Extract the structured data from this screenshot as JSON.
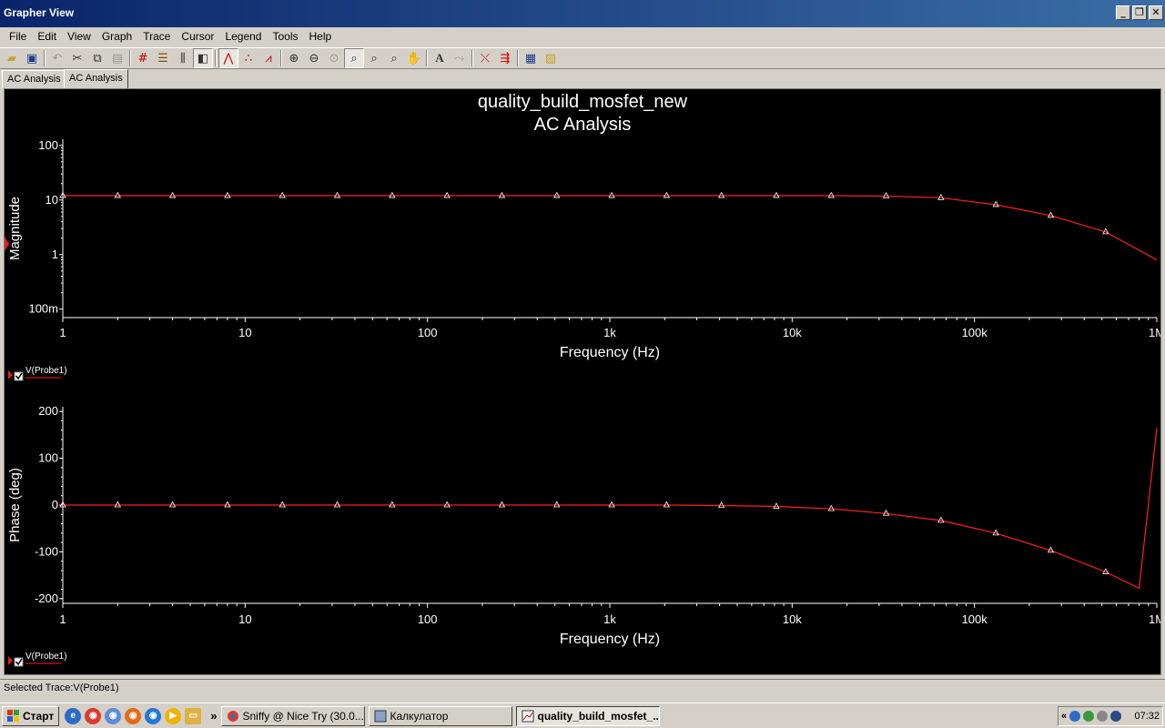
{
  "window": {
    "title": "Grapher View",
    "controls": [
      "_",
      "❐",
      "✕"
    ]
  },
  "menu": [
    "File",
    "Edit",
    "View",
    "Graph",
    "Trace",
    "Cursor",
    "Legend",
    "Tools",
    "Help"
  ],
  "tabs": [
    {
      "label": "AC Analysis",
      "active": false
    },
    {
      "label": "AC Analysis",
      "active": true
    }
  ],
  "graph": {
    "title": "quality_build_mosfet_new",
    "subtitle": "AC Analysis"
  },
  "chart_data": [
    {
      "type": "line",
      "xlabel": "Frequency (Hz)",
      "ylabel": "Magnitude",
      "x_scale": "log",
      "y_scale": "log",
      "xlim": [
        1,
        1000000
      ],
      "ylim": [
        0.07,
        130
      ],
      "x_ticks": [
        "1",
        "10",
        "100",
        "1k",
        "10k",
        "100k",
        "1M"
      ],
      "y_ticks": [
        "100",
        "10",
        "1",
        "100m"
      ],
      "grid": false,
      "legend": "bottom-left",
      "color": "#ff2020",
      "series": [
        {
          "name": "V(Probe1)",
          "x": [
            1,
            2,
            4,
            8,
            16,
            32,
            64,
            128,
            256,
            512,
            1024,
            2048,
            4096,
            8192,
            16384,
            32768,
            65536,
            131072,
            262144,
            524288,
            1000000
          ],
          "y": [
            12,
            12,
            12,
            12,
            12,
            12,
            12,
            12,
            12,
            12,
            12,
            12,
            12,
            12,
            12,
            11.8,
            11,
            8.2,
            5.2,
            2.6,
            0.8
          ]
        }
      ]
    },
    {
      "type": "line",
      "xlabel": "Frequency (Hz)",
      "ylabel": "Phase (deg)",
      "x_scale": "log",
      "y_scale": "linear",
      "xlim": [
        1,
        1000000
      ],
      "ylim": [
        -210,
        210
      ],
      "x_ticks": [
        "1",
        "10",
        "100",
        "1k",
        "10k",
        "100k",
        "1M"
      ],
      "y_ticks": [
        "200",
        "100",
        "0",
        "-100",
        "-200"
      ],
      "grid": false,
      "legend": "bottom-left",
      "color": "#ff2020",
      "series": [
        {
          "name": "V(Probe1)",
          "x": [
            1,
            2,
            4,
            8,
            16,
            32,
            64,
            128,
            256,
            512,
            1024,
            2048,
            4096,
            8192,
            16384,
            32768,
            65536,
            131072,
            262144,
            524288,
            800000,
            1000000
          ],
          "y": [
            0,
            0,
            0,
            0,
            0,
            0,
            0,
            0,
            0,
            0,
            0,
            0,
            -1,
            -3,
            -8,
            -18,
            -33,
            -60,
            -97,
            -143,
            -178,
            165
          ]
        }
      ]
    }
  ],
  "status": {
    "text": "Selected Trace:V(Probe1)"
  },
  "taskbar": {
    "start_label": "Старт",
    "tasks": [
      {
        "label": "Sniffy @ Nice Try (30.0...",
        "active": false
      },
      {
        "label": "Калкулатор",
        "active": false
      },
      {
        "label": "quality_build_mosfet_...",
        "active": true
      }
    ],
    "clock": "07:32"
  }
}
